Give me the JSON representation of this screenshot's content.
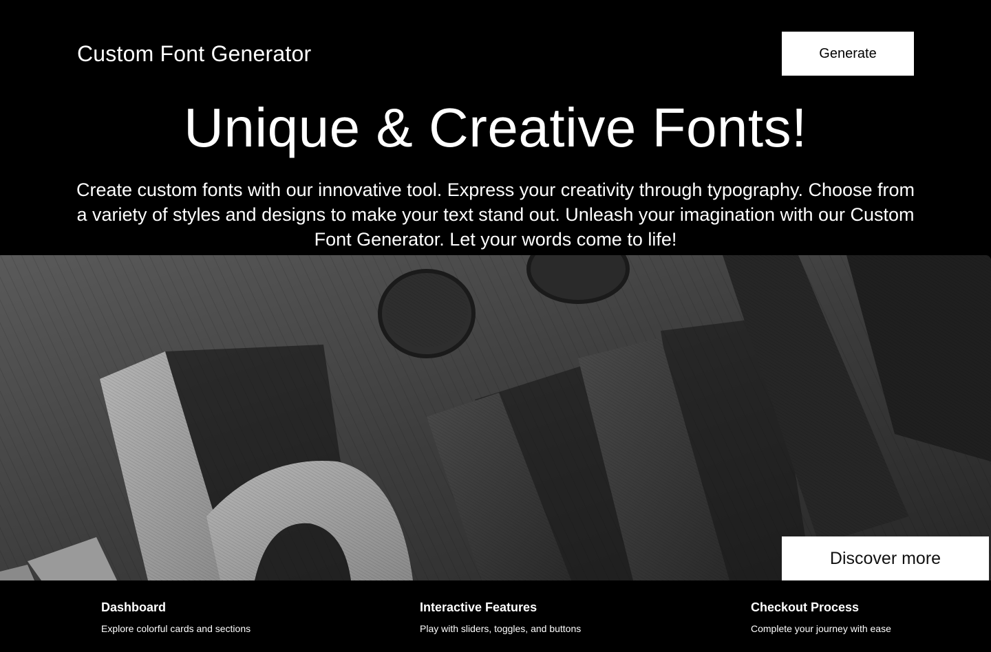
{
  "header": {
    "brand": "Custom Font Generator",
    "generate_label": "Generate"
  },
  "hero": {
    "title": "Unique & Creative Fonts!",
    "description": "Create custom fonts with our innovative tool. Express your creativity through typography. Choose from a variety of styles and designs to make your text stand out. Unleash your imagination with our Custom Font Generator. Let your words come to life!"
  },
  "image": {
    "subject": "3D printed letters on wooden surface (grayscale)",
    "discover_label": "Discover more"
  },
  "features": [
    {
      "title": "Dashboard",
      "description": "Explore colorful cards and sections"
    },
    {
      "title": "Interactive Features",
      "description": "Play with sliders, toggles, and buttons"
    },
    {
      "title": "Checkout Process",
      "description": "Complete your journey with ease"
    }
  ],
  "colors": {
    "background": "#000000",
    "text": "#ffffff",
    "button_bg": "#ffffff",
    "button_text": "#000000"
  }
}
